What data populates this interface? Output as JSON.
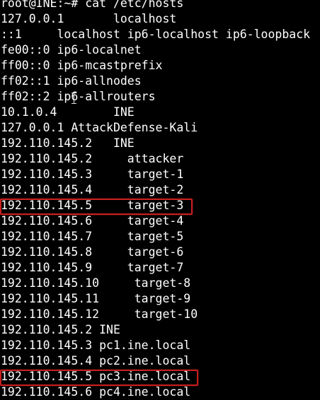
{
  "terminal": {
    "prompt": "root@INE:~# cat /etc/hosts",
    "lines": [
      "127.0.0.1       localhost",
      "::1     localhost ip6-localhost ip6-loopback",
      "fe00::0 ip6-localnet",
      "ff00::0 ip6-mcastprefix",
      "ff02::1 ip6-allnodes",
      "ff02::2 ip6-allrouters",
      "10.1.0.4        INE",
      "127.0.0.1 AttackDefense-Kali",
      "192.110.145.2   INE",
      "192.110.145.2     attacker",
      "192.110.145.3     target-1",
      "192.110.145.4     target-2",
      "192.110.145.5     target-3",
      "192.110.145.6     target-4",
      "192.110.145.7     target-5",
      "192.110.145.8     target-6",
      "192.110.145.9     target-7",
      "192.110.145.10     target-8",
      "192.110.145.11     target-9",
      "192.110.145.12     target-10",
      "192.110.145.2 INE",
      "192.110.145.3 pc1.ine.local",
      "192.110.145.4 pc2.ine.local",
      "192.110.145.5 pc3.ine.local",
      "192.110.145.6 pc4.ine.local"
    ]
  },
  "colors": {
    "background": "#000000",
    "text": "#ffffff",
    "highlight_border": "#c8201f"
  }
}
